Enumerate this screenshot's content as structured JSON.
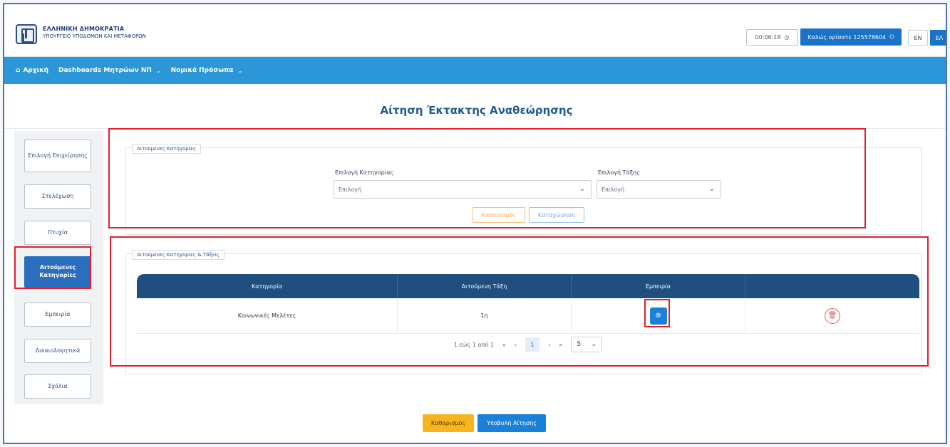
{
  "header": {
    "gov_title": "ΕΛΛΗΝΙΚΗ ΔΗΜΟΚΡΑΤΙΑ",
    "gov_subtitle": "ΥΠΟΥΡΓΕΙΟ ΥΠΟΔΟΜΩΝ ΚΑΙ ΜΕΤΑΦΟΡΩΝ",
    "timer": "00:06:18",
    "welcome": "Καλώς ορίσατε 125578604",
    "lang_en": "EN",
    "lang_el": "ΕΛ"
  },
  "nav": {
    "home": "Αρχική",
    "dashboards": "Dashboards Μητρώων ΝΠ",
    "legal_entities": "Νομικά Πρόσωπα"
  },
  "page": {
    "title": "Αίτηση Έκτακτης Αναθεώρησης"
  },
  "sidebar": {
    "items": [
      {
        "label": "Επιλογή Επιχείρησης"
      },
      {
        "label": "Στελέχωση"
      },
      {
        "label": "Πτυχία"
      },
      {
        "label": "Αιτούμενες Κατηγορίες"
      },
      {
        "label": "Εμπειρία"
      },
      {
        "label": "Δικαιολογητικά"
      },
      {
        "label": "Σχόλια"
      }
    ]
  },
  "categories_panel": {
    "legend": "Αιτούμενες Κατηγορίες",
    "category_label": "Επιλογή Κατηγορίας",
    "category_value": "Επιλογή",
    "class_label": "Επιλογή Τάξης",
    "class_value": "Επιλογή",
    "clear_button": "Καθαρισμός",
    "register_button": "Καταχώρηση"
  },
  "table_panel": {
    "legend": "Αιτούμενες Κατηγορίες & Τάξεις",
    "columns": [
      "Κατηγορία",
      "Αιτούμενη Τάξη",
      "Εμπειρία",
      ""
    ],
    "rows": [
      {
        "category": "Κοινωνικές Μελέτες",
        "class": "1η"
      }
    ],
    "pagination": {
      "summary": "1 εώς 1 από 1",
      "first": "«",
      "prev": "‹",
      "current": "1",
      "next": "›",
      "last": "»",
      "page_size": "5"
    }
  },
  "footer": {
    "clear_button": "Καθαρισμός",
    "submit_button": "Υποβολή Αίτησης"
  },
  "colors": {
    "primary": "#1a80d8",
    "nav": "#2b97d9",
    "table_header": "#1f4f7f",
    "accent_yellow": "#f6b51e",
    "annotation_red": "#e0202a"
  }
}
